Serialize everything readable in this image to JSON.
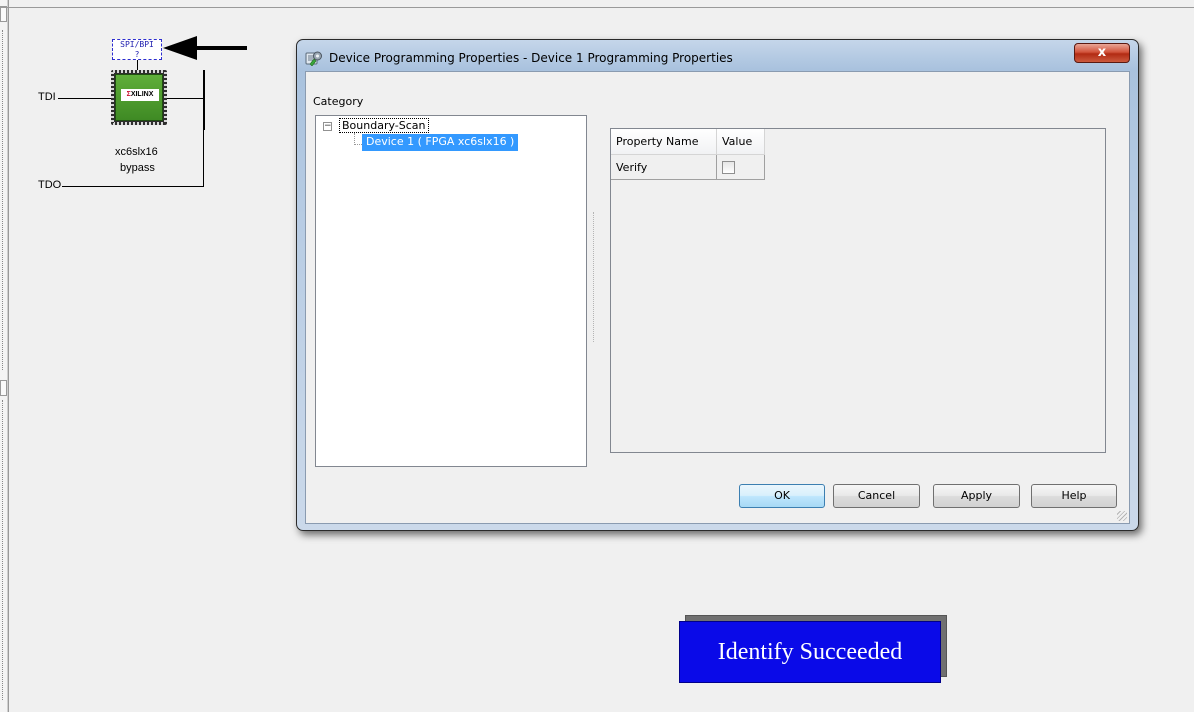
{
  "chain": {
    "tdi_label": "TDI",
    "tdo_label": "TDO",
    "flash_box_label": "SPI/BPI",
    "flash_box_sub": "?",
    "chip_brand": "XILINX",
    "device_name": "xc6slx16",
    "device_state": "bypass"
  },
  "dialog": {
    "title": "Device Programming Properties - Device 1 Programming Properties",
    "close_label": "x",
    "category_label": "Category",
    "tree": {
      "root_label": "Boundary-Scan",
      "expander": "−",
      "child_label": "Device 1 ( FPGA xc6slx16 )"
    },
    "grid": {
      "col_property": "Property Name",
      "col_value": "Value",
      "rows": [
        {
          "name": "Verify",
          "checked": false
        }
      ]
    },
    "buttons": {
      "ok": "OK",
      "cancel": "Cancel",
      "apply": "Apply",
      "help": "Help"
    }
  },
  "status_banner": {
    "text": "Identify Succeeded",
    "color": "#0a0ae8"
  },
  "icons": [
    "programming-properties-icon",
    "close-icon",
    "tree-collapse-icon",
    "arrow-left-icon",
    "xilinx-chip-icon"
  ]
}
